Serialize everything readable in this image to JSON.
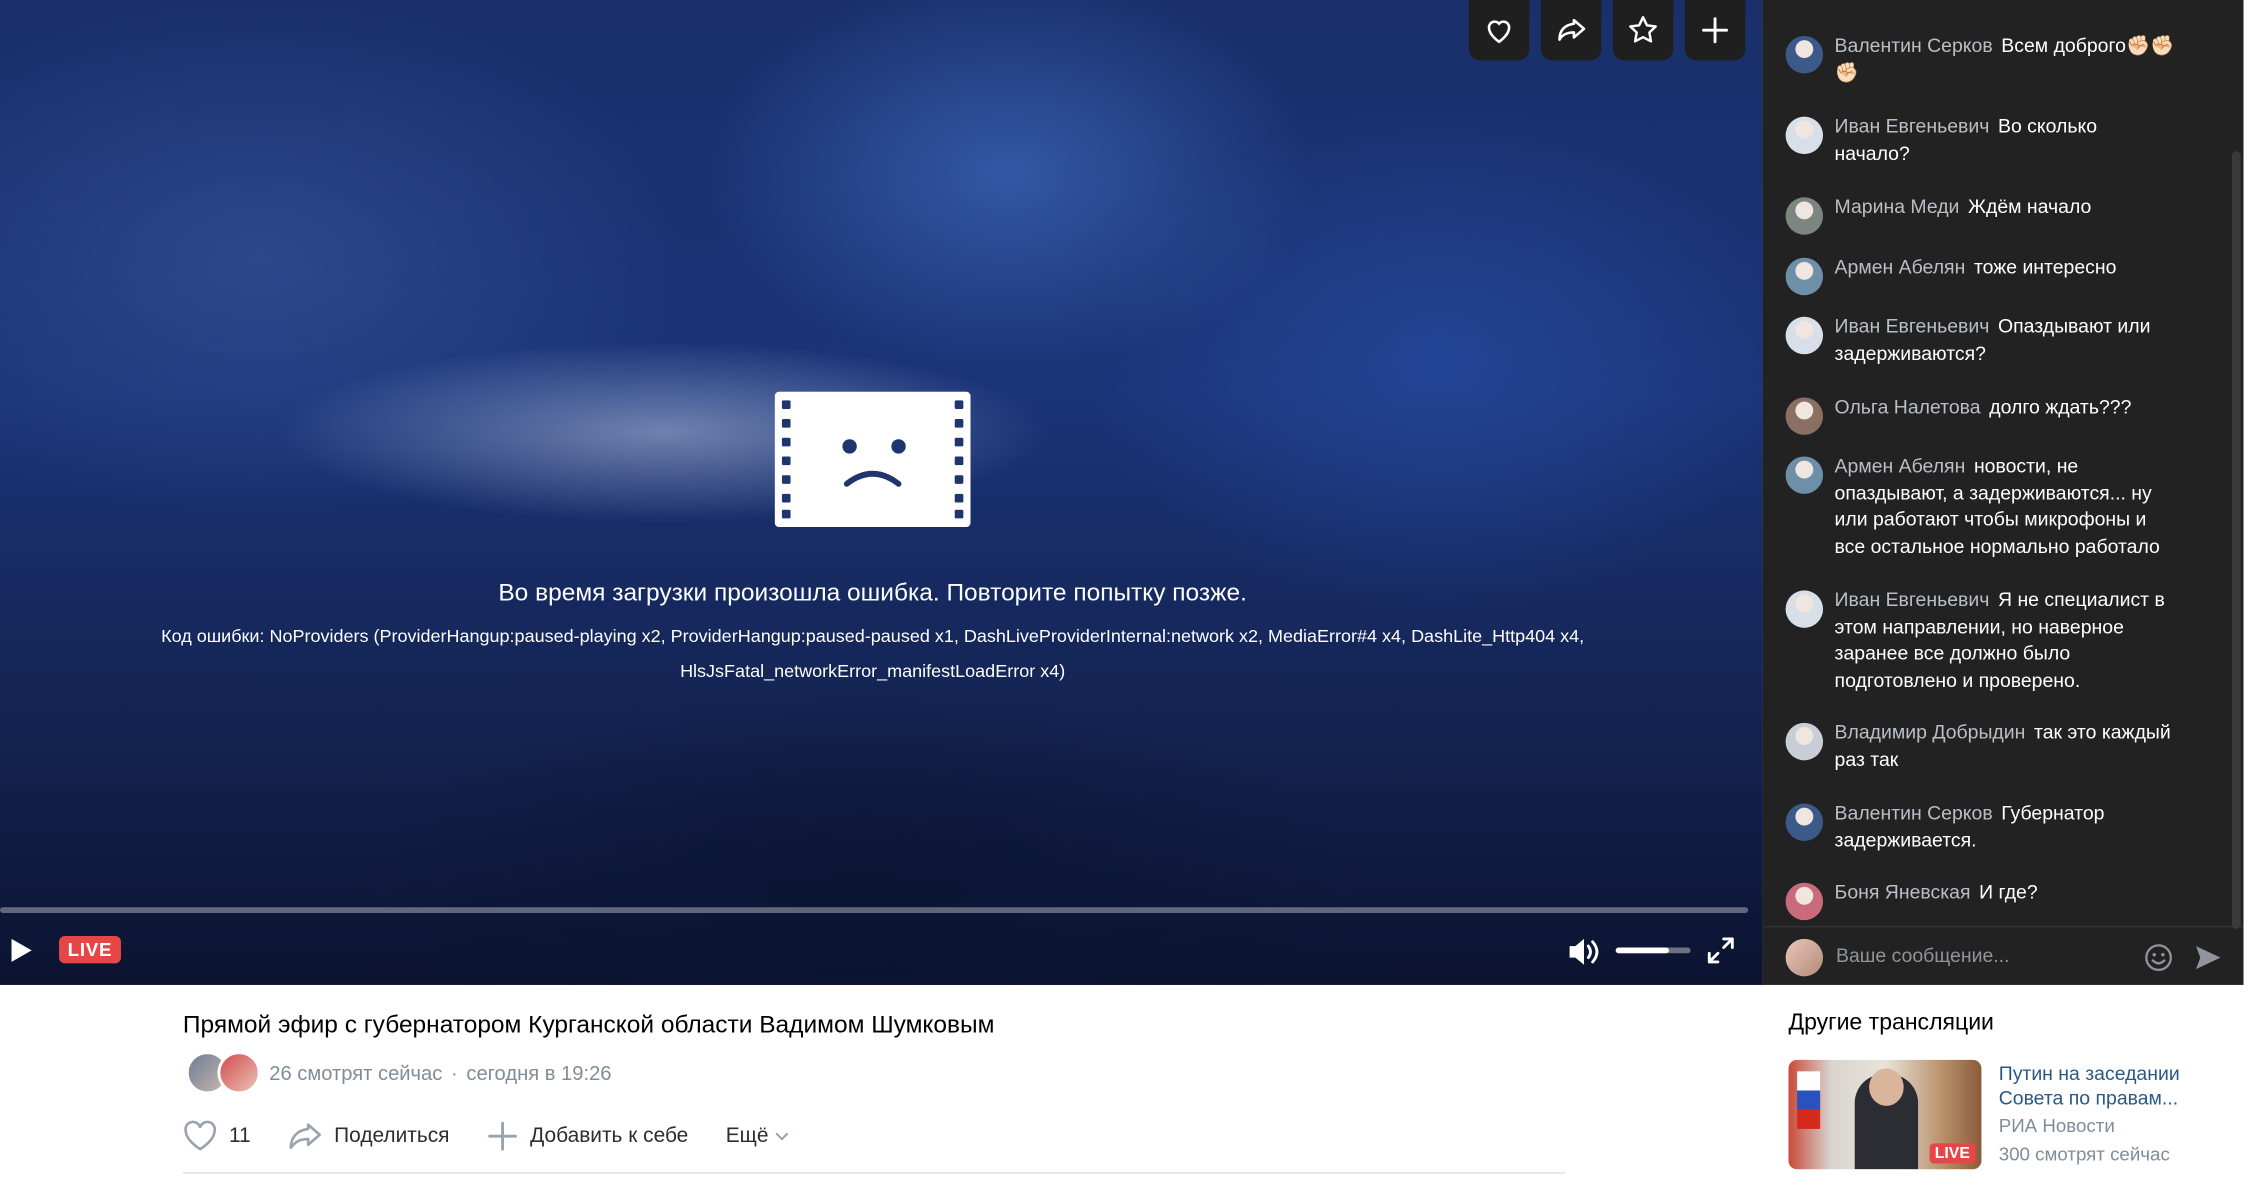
{
  "video": {
    "top_actions": [
      {
        "icon": "heart-icon"
      },
      {
        "icon": "share-icon"
      },
      {
        "icon": "star-icon"
      },
      {
        "icon": "plus-icon"
      }
    ],
    "error": {
      "icon": "sad-film-icon",
      "title": "Во время загрузки произошла ошибка. Повторите попытку позже.",
      "code_line1": "Код ошибки: NoProviders (ProviderHangup:paused-playing x2, ProviderHangup:paused-paused x1, DashLiveProviderInternal:network x2, MediaError#4 x4, DashLite_Http404 x4,",
      "code_line2": "HlsJsFatal_networkError_manifestLoadError x4)"
    },
    "controls": {
      "live_label": "LIVE",
      "volume_level": 0.72,
      "icons": [
        "play-icon",
        "volume-icon",
        "fullscreen-icon"
      ]
    }
  },
  "chat": {
    "messages": [
      {
        "author": "Валентин Серков",
        "text": "Всем доброго✊🏻✊🏻✊🏻",
        "avatar_color": "#3b5a8a"
      },
      {
        "author": "Иван Евгеньевич",
        "text": "Во сколько начало?",
        "avatar_color": "#d9dfe8"
      },
      {
        "author": "Марина Меди",
        "text": "Ждём начало",
        "avatar_color": "#7d8580"
      },
      {
        "author": "Армен Абелян",
        "text": "тоже интересно",
        "avatar_color": "#6e8fa8"
      },
      {
        "author": "Иван Евгеньевич",
        "text": "Опаздывают или задерживаются?",
        "avatar_color": "#d9dfe8"
      },
      {
        "author": "Ольга Налетова",
        "text": "долго ждать???",
        "avatar_color": "#8a6f62"
      },
      {
        "author": "Армен Абелян",
        "text": "новости, не опаздывают, а задерживаются... ну или работают чтобы микрофоны и все остальное нормально работало",
        "avatar_color": "#6e8fa8"
      },
      {
        "author": "Иван Евгеньевич",
        "text": "Я не специалист в этом направлении, но наверное заранее все должно было подготовлено и проверено.",
        "avatar_color": "#d9dfe8"
      },
      {
        "author": "Владимир Добрыдин",
        "text": "так это каждый раз так",
        "avatar_color": "#c9ced6"
      },
      {
        "author": "Валентин Серков",
        "text": "Губернатор задерживается.",
        "avatar_color": "#3b5a8a"
      },
      {
        "author": "Боня Яневская",
        "text": "И где?",
        "avatar_color": "#c96b7a"
      }
    ],
    "input_placeholder": "Ваше сообщение..."
  },
  "stream": {
    "title": "Прямой эфир с губернатором Курганской области Вадимом Шумковым",
    "viewers": "26 смотрят сейчас",
    "separator": "·",
    "time": "сегодня в 19:26",
    "likes": "11",
    "share_label": "Поделиться",
    "add_label": "Добавить к себе",
    "more_label": "Ещё"
  },
  "other_streams": {
    "heading": "Другие трансляции",
    "items": [
      {
        "title": "Путин на заседании Совета по правам...",
        "source": "РИА Новости",
        "viewers": "300 смотрят сейчас",
        "badge": "LIVE"
      }
    ]
  }
}
